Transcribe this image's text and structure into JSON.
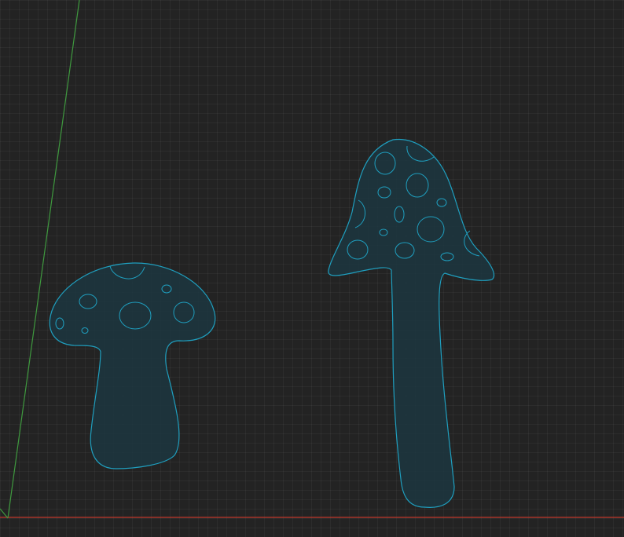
{
  "canvas": {
    "background_color": "#232323",
    "grid_color": "#2d2d2d"
  },
  "axes": {
    "y_axis_color": "#3f9a3f",
    "x_axis_color": "#c0392b"
  },
  "shapes": {
    "stroke_color": "#1f9fbf",
    "fill_color": "#1c3640",
    "items": [
      {
        "name": "small-mushroom"
      },
      {
        "name": "tall-mushroom"
      }
    ]
  }
}
